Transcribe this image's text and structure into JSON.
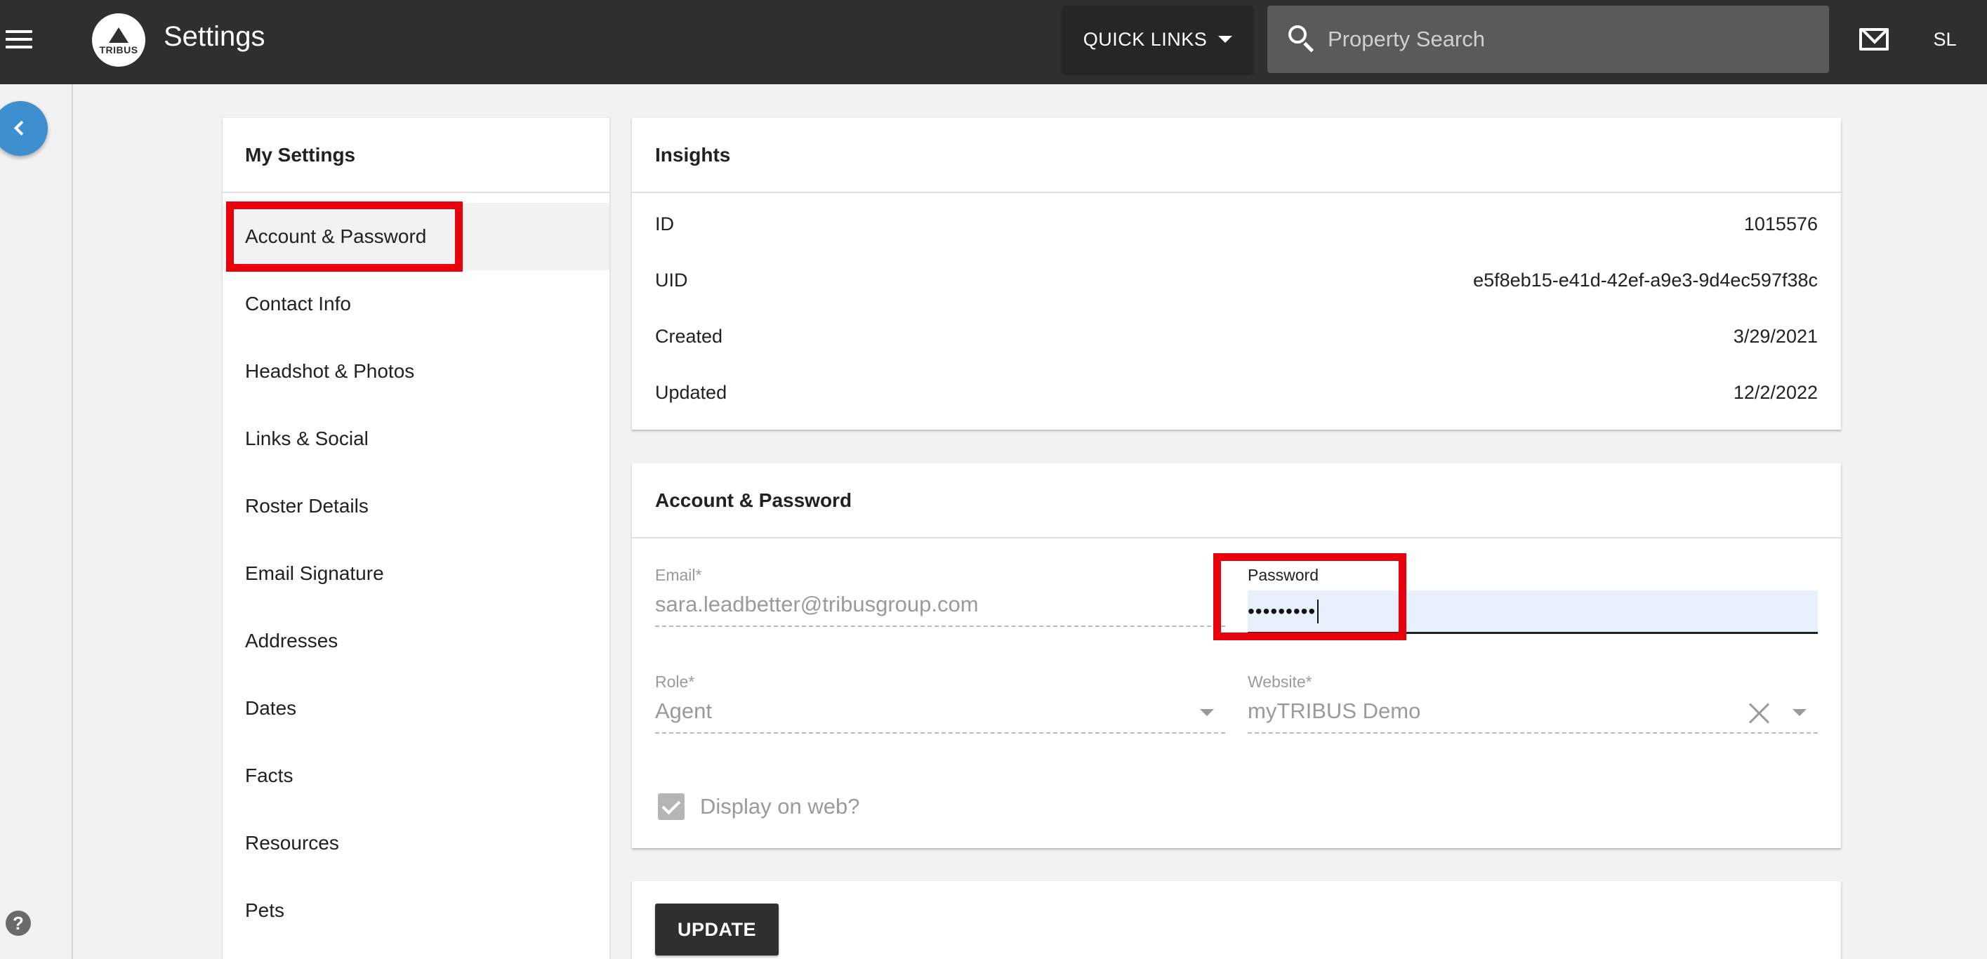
{
  "header": {
    "app_title": "Settings",
    "logo_text": "TRIBUS",
    "quick_links_label": "QUICK LINKS",
    "search_placeholder": "Property Search",
    "avatar_initials": "SL"
  },
  "help_label": "?",
  "settings_menu": {
    "title": "My Settings",
    "items": [
      {
        "label": "Account & Password",
        "active": true
      },
      {
        "label": "Contact Info"
      },
      {
        "label": "Headshot & Photos"
      },
      {
        "label": "Links & Social"
      },
      {
        "label": "Roster Details"
      },
      {
        "label": "Email Signature"
      },
      {
        "label": "Addresses"
      },
      {
        "label": "Dates"
      },
      {
        "label": "Facts"
      },
      {
        "label": "Resources"
      },
      {
        "label": "Pets"
      }
    ]
  },
  "insights": {
    "title": "Insights",
    "rows": [
      {
        "label": "ID",
        "value": "1015576"
      },
      {
        "label": "UID",
        "value": "e5f8eb15-e41d-42ef-a9e3-9d4ec597f38c"
      },
      {
        "label": "Created",
        "value": "3/29/2021"
      },
      {
        "label": "Updated",
        "value": "12/2/2022"
      }
    ]
  },
  "account": {
    "title": "Account & Password",
    "email": {
      "label": "Email*",
      "value": "sara.leadbetter@tribusgroup.com"
    },
    "password": {
      "label": "Password",
      "value": "•••••••••"
    },
    "role": {
      "label": "Role*",
      "value": "Agent"
    },
    "website": {
      "label": "Website*",
      "value": "myTRIBUS Demo"
    },
    "display_on_web": {
      "label": "Display on web?",
      "checked": true
    }
  },
  "update_button_label": "UPDATE",
  "colors": {
    "topbar": "#2f2f2f",
    "accent_blue": "#3d8fd0",
    "highlight_red": "#e8000b",
    "password_fill": "#e8f0fe"
  }
}
